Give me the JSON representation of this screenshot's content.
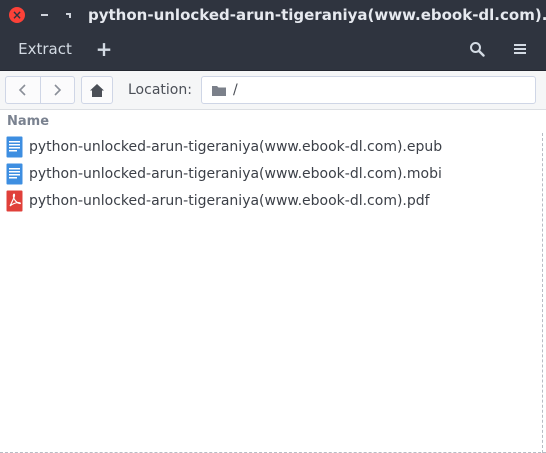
{
  "window": {
    "title": "python-unlocked-arun-tigeraniya(www.ebook-dl.com).zip"
  },
  "headerbar": {
    "extract_label": "Extract",
    "add_label": "+"
  },
  "toolbar": {
    "location_label": "Location:",
    "location_path": "/"
  },
  "filelist": {
    "column_name": "Name",
    "files": [
      {
        "name": "python-unlocked-arun-tigeraniya(www.ebook-dl.com).epub",
        "icon": "document-icon",
        "color": "#3d8ee1"
      },
      {
        "name": "python-unlocked-arun-tigeraniya(www.ebook-dl.com).mobi",
        "icon": "document-icon",
        "color": "#3d8ee1"
      },
      {
        "name": "python-unlocked-arun-tigeraniya(www.ebook-dl.com).pdf",
        "icon": "pdf-icon",
        "color": "#e0403a"
      }
    ]
  },
  "colors": {
    "titlebar": "#2f343f",
    "close": "#fc4138"
  }
}
